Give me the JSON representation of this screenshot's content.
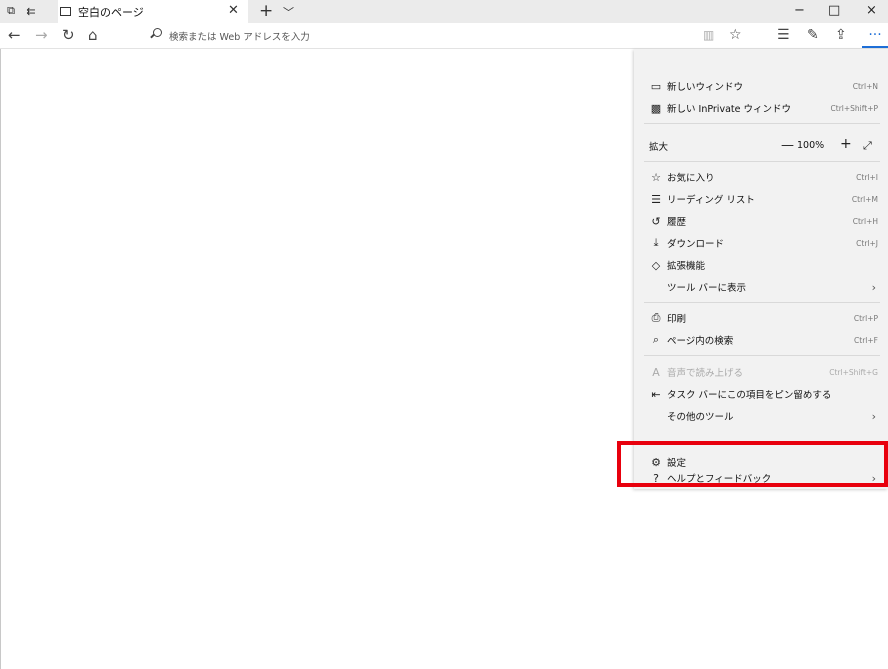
{
  "tab": {
    "title": "空白のページ"
  },
  "window": {
    "minimize": "−",
    "maximize": "□",
    "close": "×"
  },
  "address_bar": {
    "placeholder": "検索または Web アドレスを入力"
  },
  "toolbar": {
    "more_label": "···"
  },
  "menu": {
    "new_window": {
      "label": "新しいウィンドウ",
      "shortcut": "Ctrl+N"
    },
    "new_inprivate": {
      "label": "新しい InPrivate ウィンドウ",
      "shortcut": "Ctrl+Shift+P"
    },
    "zoom": {
      "label": "拡大",
      "minus": "—",
      "value": "100%",
      "plus": "+"
    },
    "favorites": {
      "label": "お気に入り",
      "shortcut": "Ctrl+I"
    },
    "reading_list": {
      "label": "リーディング リスト",
      "shortcut": "Ctrl+M"
    },
    "history": {
      "label": "履歴",
      "shortcut": "Ctrl+H"
    },
    "downloads": {
      "label": "ダウンロード",
      "shortcut": "Ctrl+J"
    },
    "extensions": {
      "label": "拡張機能"
    },
    "show_in_toolbar": {
      "label": "ツール バーに表示"
    },
    "print": {
      "label": "印刷",
      "shortcut": "Ctrl+P"
    },
    "find_on_page": {
      "label": "ページ内の検索",
      "shortcut": "Ctrl+F"
    },
    "read_aloud": {
      "label": "音声で読み上げる",
      "shortcut": "Ctrl+Shift+G"
    },
    "pin_taskbar": {
      "label": "タスク バーにこの項目をピン留めする"
    },
    "more_tools": {
      "label": "その他のツール"
    },
    "settings": {
      "label": "設定"
    },
    "help_feedback": {
      "label": "ヘルプとフィードバック"
    }
  },
  "colors": {
    "accent": "#1e6fd8",
    "highlight": "#e8000d"
  }
}
